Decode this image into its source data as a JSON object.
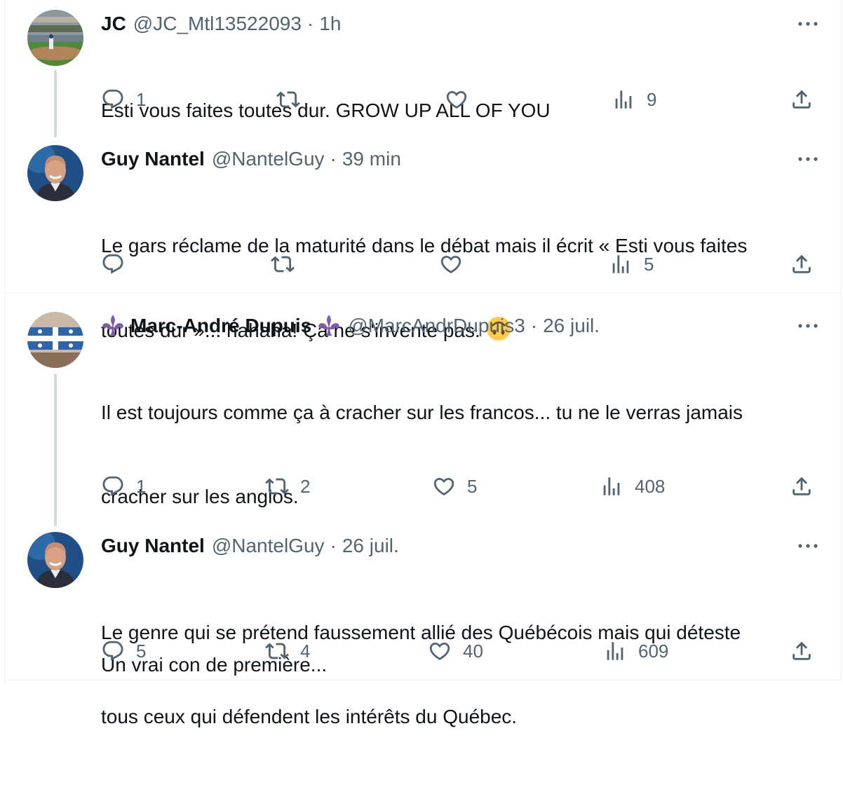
{
  "tweets": [
    {
      "name": "JC",
      "handle": "@JC_Mtl13522093",
      "dot": "·",
      "time": "1h",
      "avatar_icon": "baseball-stadium-avatar",
      "text_lines": [
        "Esti vous faites toutes dur. GROW UP ALL OF YOU"
      ],
      "replies": "1",
      "retweets": "",
      "likes": "",
      "views": "9"
    },
    {
      "name": "Guy Nantel",
      "handle": "@NantelGuy",
      "dot": "·",
      "time": "39 min",
      "avatar_icon": "smiling-man-avatar",
      "text_lines": [
        "Le gars réclame de la maturité dans le débat mais il écrit « Esti vous faites",
        "toutes dur »... hahaha! Ça ne s'invente pas."
      ],
      "emoji": "upside-down-face",
      "replies": "",
      "retweets": "",
      "likes": "",
      "views": "5"
    },
    {
      "name": "Marc-André Dupuis",
      "handle": "@MarcAndrDupuis3",
      "dot": "·",
      "time": "26 juil.",
      "avatar_icon": "quebec-flag-avatar",
      "name_icons": "fleur-de-lis-icon",
      "text_lines": [
        "Il est toujours comme ça à cracher sur les francos... tu ne le verras jamais",
        "cracher sur les anglos.",
        "",
        "Un vrai con de première..."
      ],
      "replies": "1",
      "retweets": "2",
      "likes": "5",
      "views": "408"
    },
    {
      "name": "Guy Nantel",
      "handle": "@NantelGuy",
      "dot": "·",
      "time": "26 juil.",
      "avatar_icon": "smiling-man-avatar",
      "text_lines": [
        "Le genre qui se prétend faussement allié des Québécois mais qui déteste",
        "tous ceux qui défendent les intérêts du Québec."
      ],
      "replies": "5",
      "retweets": "4",
      "likes": "40",
      "views": "609"
    }
  ],
  "colors": {
    "text": "#0f1419",
    "secondary": "#536471",
    "thread_line": "#cfd9de",
    "divider": "#eff3f4",
    "fleur_de_lis": "#7e5aa7"
  }
}
